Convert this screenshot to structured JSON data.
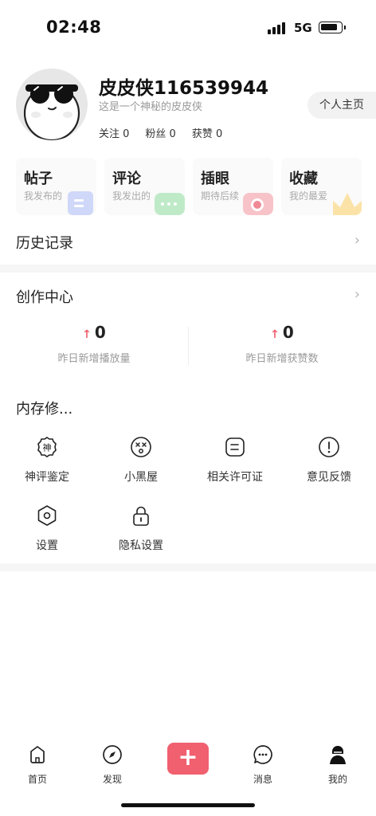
{
  "status": {
    "time": "02:48",
    "network": "5G"
  },
  "profile": {
    "username": "皮皮侠116539944",
    "bio": "这是一个神秘的皮皮侠",
    "stats": {
      "following": "关注 0",
      "followers": "粉丝 0",
      "likes": "获赞 0"
    },
    "homepage_label": "个人主页"
  },
  "cards": [
    {
      "title": "帖子",
      "subtitle": "我发布的",
      "color": "#cfd8f8",
      "icon": "post-icon"
    },
    {
      "title": "评论",
      "subtitle": "我发出的",
      "color": "#bfeac8",
      "icon": "comment-icon"
    },
    {
      "title": "插眼",
      "subtitle": "期待后续",
      "color": "#f7c3c8",
      "icon": "eye-icon"
    },
    {
      "title": "收藏",
      "subtitle": "我的最爱",
      "color": "#fbe3a8",
      "icon": "crown-icon"
    }
  ],
  "history": {
    "title": "历史记录"
  },
  "creator": {
    "title": "创作中心",
    "metrics": [
      {
        "value": "0",
        "label": "昨日新增播放量"
      },
      {
        "value": "0",
        "label": "昨日新增获赞数"
      }
    ]
  },
  "tools": {
    "title": "内存修...",
    "items": [
      {
        "label": "神评鉴定",
        "icon": "shen-badge-icon"
      },
      {
        "label": "小黑屋",
        "icon": "dizzy-face-icon"
      },
      {
        "label": "相关许可证",
        "icon": "license-icon"
      },
      {
        "label": "意见反馈",
        "icon": "exclamation-icon"
      },
      {
        "label": "设置",
        "icon": "settings-hexagon-icon"
      },
      {
        "label": "隐私设置",
        "icon": "lock-icon"
      }
    ]
  },
  "tabbar": {
    "items": [
      {
        "label": "首页",
        "icon": "home-icon"
      },
      {
        "label": "发现",
        "icon": "compass-icon"
      },
      {
        "label": "消息",
        "icon": "message-icon"
      },
      {
        "label": "我的",
        "icon": "profile-ninja-icon"
      }
    ],
    "plus_label": "+"
  },
  "colors": {
    "accent": "#f0606f",
    "muted": "#9a9a9a",
    "divider": "#f6f6f6"
  }
}
